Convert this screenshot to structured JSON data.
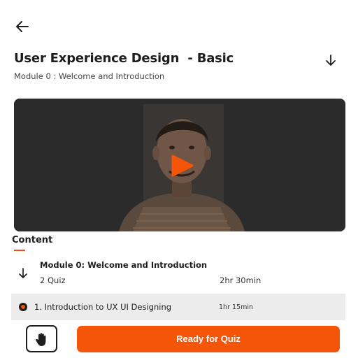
{
  "header": {
    "back_icon": "arrow-left-icon",
    "title": "User Experience Design  - Basic",
    "download_icon": "arrow-down-icon",
    "subtitle": "Module 0 : Welcome and Introduction"
  },
  "video": {
    "play_icon": "play-icon",
    "accent": "#f55508"
  },
  "content": {
    "tab_label": "Content",
    "module": {
      "toggle_icon": "arrow-down-icon",
      "title": "Module 0: Welcome and Introduction",
      "quiz_count": "2 Quiz",
      "duration": "2hr 30min"
    },
    "lessons": [
      {
        "title": "1. Introduction to UX UI Designing",
        "duration": "1hr 15min",
        "icon": "radio-dot-icon"
      }
    ]
  },
  "footer": {
    "hand_icon": "raise-hand-icon",
    "quiz_button_label": "Ready for Quiz"
  },
  "colors": {
    "primary": "#f55508",
    "text": "#1d1d1d",
    "lesson_row_bg": "#ececec"
  }
}
